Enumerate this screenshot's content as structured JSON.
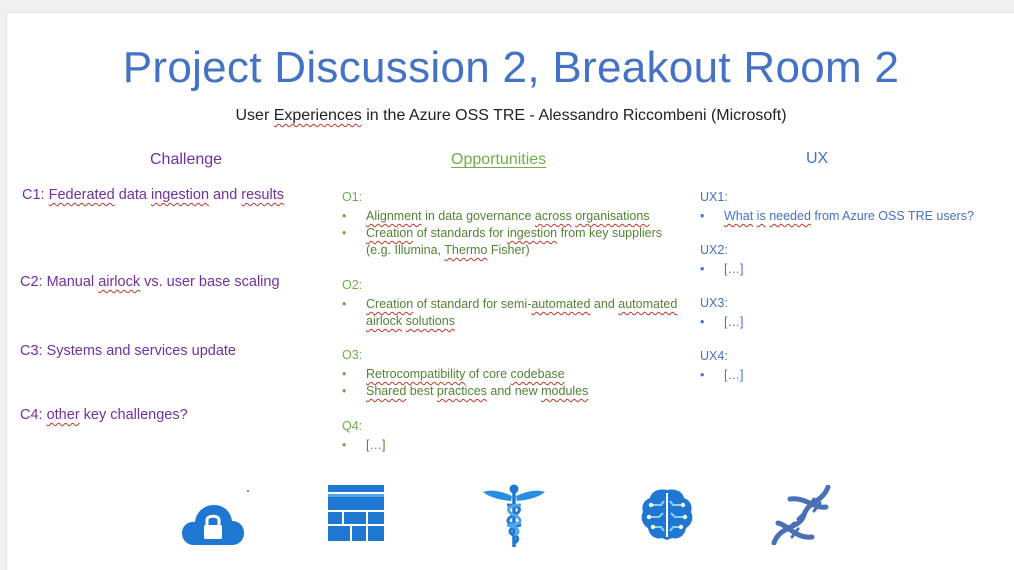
{
  "slide": {
    "title": "Project Discussion 2, Breakout Room 2",
    "subtitle": {
      "pre": "User ",
      "word": "Experiences",
      "post": " in the Azure OSS TRE - Alessandro Riccombeni (Microsoft)"
    }
  },
  "columns": {
    "challenge": "Challenge",
    "opportunities": "Opportunities",
    "ux": "UX"
  },
  "challenges": {
    "c1": {
      "a": "C1: ",
      "b": "Federated",
      "c": " data ",
      "d": "ingestion",
      "e": " and ",
      "f": "results"
    },
    "c2": {
      "a": "C2: Manual ",
      "b": "airlock",
      "c": " vs. user base scaling"
    },
    "c3": "C3: Systems and services update",
    "c4": {
      "a": "C4: ",
      "b": "other",
      "c": " key challenges?"
    }
  },
  "opportunities": {
    "o1": {
      "label": "O1:",
      "i1": {
        "a": "Alignment",
        "b": " in data governance ",
        "c": "across",
        "d": " ",
        "e": "organisations"
      },
      "i2": {
        "a": "Creation",
        "b": " of standards for ",
        "c": "ingestion",
        "d": " from key suppliers (e.g. Illumina, ",
        "e": "Thermo",
        "f": " Fisher)"
      }
    },
    "o2": {
      "label": "O2:",
      "i1": {
        "a": "Creation",
        "b": " of standard for semi-",
        "c": "automated",
        "d": " and ",
        "e": "automated",
        "f": " ",
        "g": "airlock",
        "h": " ",
        "i": "solutions"
      }
    },
    "o3": {
      "label": "O3:",
      "i1": {
        "a": "Retrocompatibility",
        "b": " of core ",
        "c": "codebase"
      },
      "i2": {
        "a": "Shared",
        "b": " best ",
        "c": "practices",
        "d": " and new ",
        "e": "modules"
      }
    },
    "o4": {
      "label": "Q4:",
      "i1": "[…]"
    }
  },
  "ux": {
    "u1": {
      "label": "UX1:",
      "i1": {
        "a": "What",
        "b": " ",
        "c": "is",
        "d": " ",
        "e": "needed",
        "f": " from Azure OSS TRE users?"
      }
    },
    "u2": {
      "label": "UX2:",
      "i1": "[…]"
    },
    "u3": {
      "label": "UX3:",
      "i1": "[…]"
    },
    "u4": {
      "label": "UX4:",
      "i1": "[…]"
    }
  },
  "icons": [
    "cloud-lock-icon",
    "table-layout-icon",
    "caduceus-icon",
    "brain-circuit-icon",
    "dna-icon"
  ],
  "colors": {
    "title": "#4472c4",
    "challenge": "#7030a0",
    "opportunities": "#70ad47",
    "ux": "#4472c4",
    "icon_blue": "#1e78d2"
  }
}
